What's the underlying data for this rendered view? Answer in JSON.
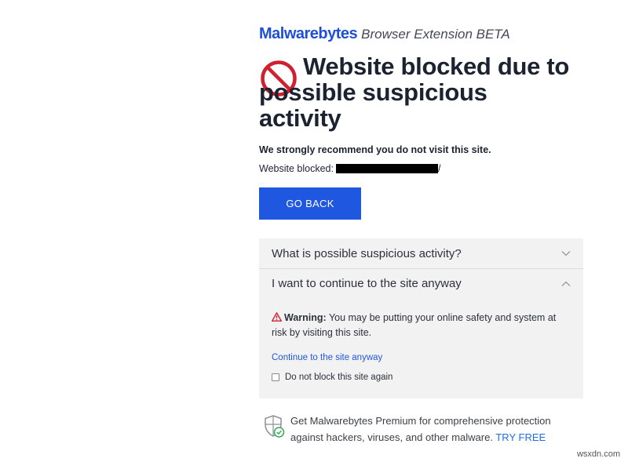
{
  "brand": {
    "logo": "Malwarebytes",
    "subtitle": "Browser Extension BETA"
  },
  "headline": "Website blocked due to possible suspicious activity",
  "recommendation": "We strongly recommend you do not visit this site.",
  "blocked": {
    "label": "Website blocked:",
    "suffix": "/"
  },
  "go_back_label": "GO BACK",
  "accordion": {
    "item1": "What is possible suspicious activity?",
    "item2": "I want to continue to the site anyway"
  },
  "warning": {
    "title": "Warning:",
    "text": "You may be putting your online safety and system at risk by visiting this site."
  },
  "continue_link": "Continue to the site anyway",
  "checkbox_label": "Do not block this site again",
  "promo": {
    "text": "Get Malwarebytes Premium for comprehensive protection against hackers, viruses, and other malware.",
    "cta": "TRY FREE"
  },
  "watermark": "wsxdn.com",
  "colors": {
    "accent": "#1f57e0",
    "block_red": "#d11f30",
    "warning_red": "#d11f30",
    "panel_bg": "#f2f2f2"
  },
  "icons": [
    "blocked-icon",
    "chevron-down-icon",
    "chevron-up-icon",
    "warning-icon",
    "shield-check-icon"
  ]
}
